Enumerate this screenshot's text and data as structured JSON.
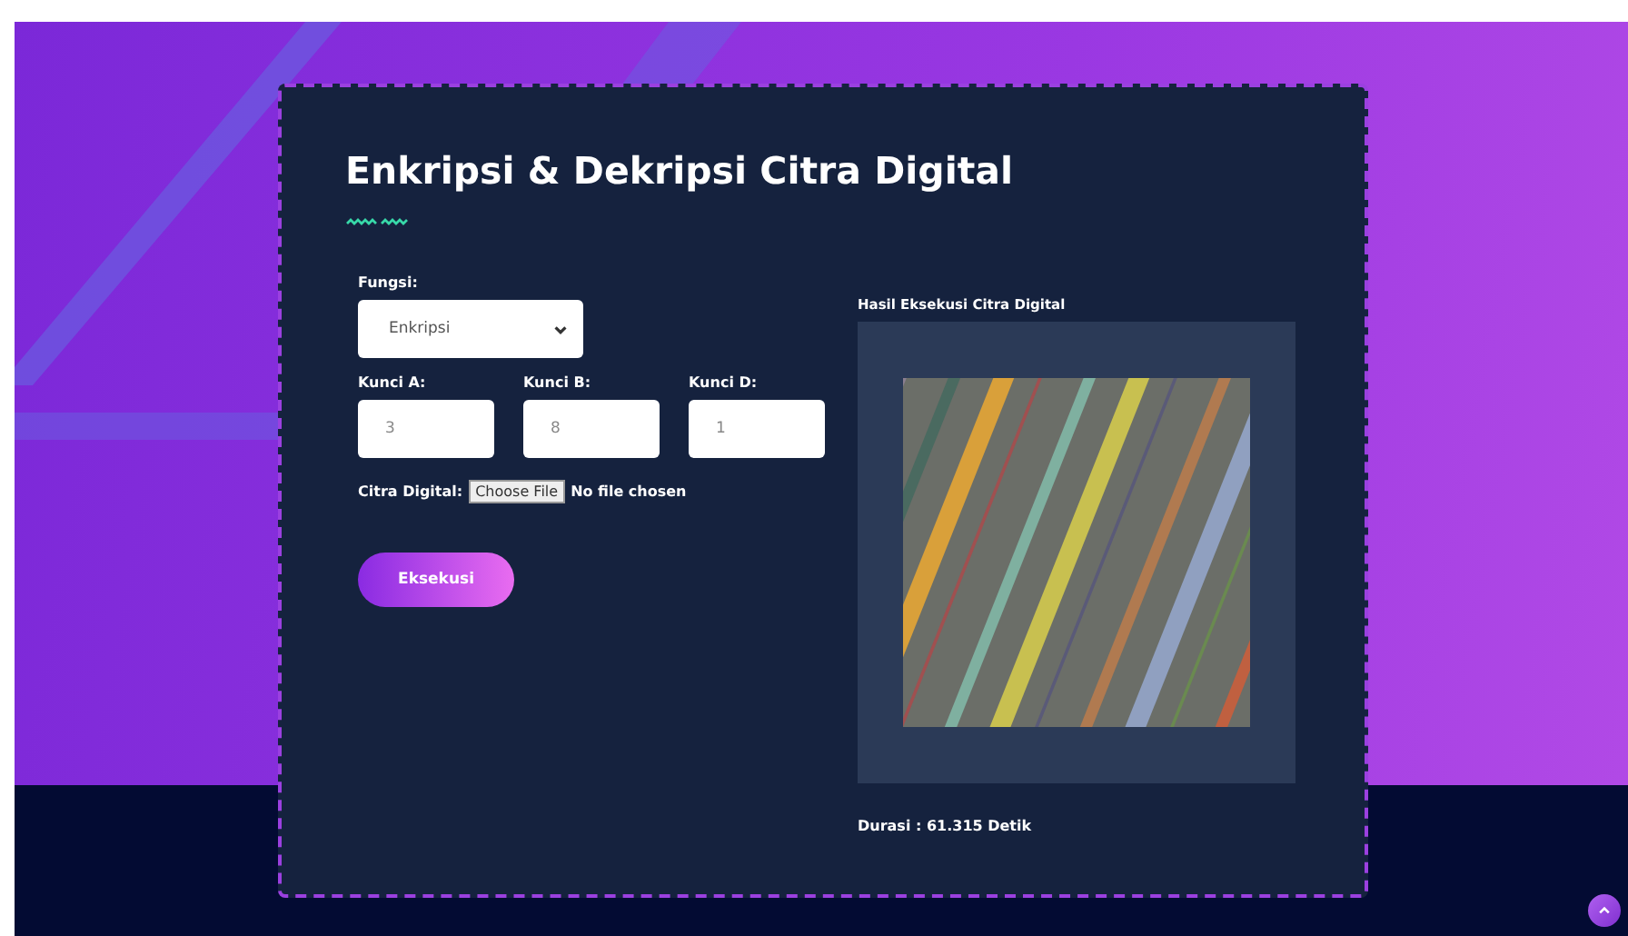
{
  "title": "Enkripsi & Dekripsi Citra Digital",
  "form": {
    "function": {
      "label": "Fungsi:",
      "value": "Enkripsi"
    },
    "keys": [
      {
        "label": "Kunci A:",
        "placeholder": "3"
      },
      {
        "label": "Kunci B:",
        "placeholder": "8"
      },
      {
        "label": "Kunci D:",
        "placeholder": "1"
      }
    ],
    "file": {
      "label": "Citra Digital:",
      "button": "Choose File",
      "status": "No file chosen"
    },
    "submit": "Eksekusi"
  },
  "result": {
    "title": "Hasil Eksekusi Citra Digital",
    "duration": "Durasi : 61.315 Detik"
  }
}
